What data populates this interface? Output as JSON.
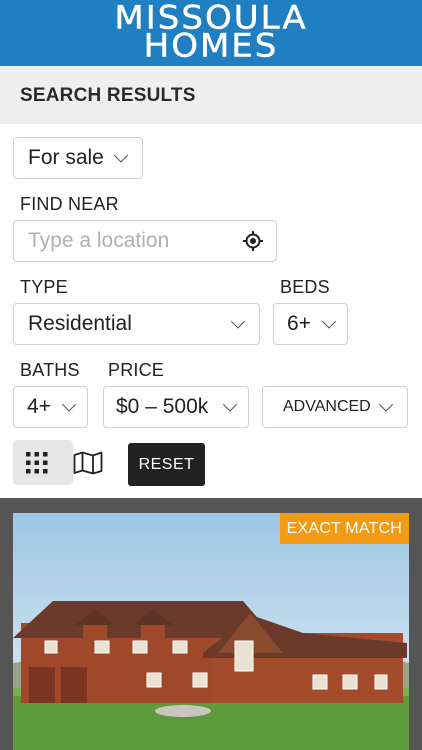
{
  "header": {
    "logo_line1": "MISSOULA",
    "logo_line2": "HOMES",
    "bg_color": "#1f7fc0"
  },
  "subheader": {
    "title": "SEARCH RESULTS"
  },
  "filters": {
    "listing_status": {
      "value": "For sale"
    },
    "find_near": {
      "label": "FIND NEAR",
      "placeholder": "Type a location",
      "icon": "crosshair-icon"
    },
    "type": {
      "label": "TYPE",
      "value": "Residential"
    },
    "beds": {
      "label": "BEDS",
      "value": "6+"
    },
    "baths": {
      "label": "BATHS",
      "value": "4+"
    },
    "price": {
      "label": "PRICE",
      "value": "$0 – 500k"
    },
    "advanced": {
      "label": "ADVANCED"
    }
  },
  "view_toggle": {
    "grid_icon": "grid-icon",
    "map_icon": "map-icon",
    "active": "grid"
  },
  "reset_label": "RESET",
  "result": {
    "badge": "EXACT MATCH",
    "badge_color": "#f39b15"
  }
}
